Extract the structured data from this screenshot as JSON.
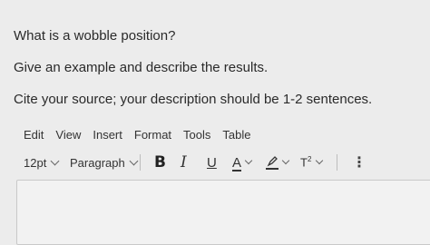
{
  "question": {
    "line1": "What is a wobble position?",
    "line2": "Give an example and describe the results.",
    "line3": "Cite your source; your description should be 1-2 sentences."
  },
  "menubar": {
    "items": [
      "Edit",
      "View",
      "Insert",
      "Format",
      "Tools",
      "Table"
    ]
  },
  "toolbar": {
    "font_size": "12pt",
    "block_format": "Paragraph",
    "bold": "B",
    "italic": "I",
    "underline": "U",
    "font_color": "A",
    "superscript_base": "T",
    "superscript_exp": "2",
    "more": "⋮",
    "icons": [
      "chevron-down-icon",
      "highlight-pen-icon",
      "more-options-icon"
    ]
  },
  "editor": {
    "value": ""
  }
}
